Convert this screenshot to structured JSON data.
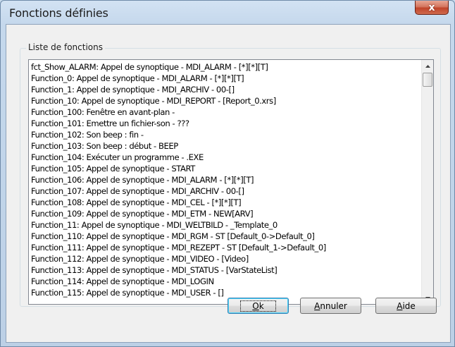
{
  "window": {
    "title": "Fonctions définies",
    "close_label": "x"
  },
  "group": {
    "legend": "Liste de fonctions"
  },
  "functions": [
    "fct_Show_ALARM: Appel de synoptique - MDI_ALARM - [*][*][T]",
    "Function_0: Appel de synoptique - MDI_ALARM - [*][*][T]",
    "Function_1: Appel de synoptique - MDI_ARCHIV - 00-[]",
    "Function_10: Appel de synoptique - MDI_REPORT - [Report_0.xrs]",
    "Function_100: Fenêtre en avant-plan -",
    "Function_101: Emettre un fichier-son - ???",
    "Function_102: Son beep : fin -",
    "Function_103: Son beep : début - BEEP",
    "Function_104: Exécuter un programme - .EXE",
    "Function_105: Appel de synoptique - START",
    "Function_106: Appel de synoptique - MDI_ALARM - [*][*][T]",
    "Function_107: Appel de synoptique - MDI_ARCHIV - 00-[]",
    "Function_108: Appel de synoptique - MDI_CEL - [*][*][T]",
    "Function_109: Appel de synoptique - MDI_ETM - NEW[ARV]",
    "Function_11: Appel de synoptique - MDI_WELTBILD - _Template_0",
    "Function_110: Appel de synoptique - MDI_RGM - ST [Default_0->Default_0]",
    "Function_111: Appel de synoptique - MDI_REZEPT - ST [Default_1->Default_0]",
    "Function_112: Appel de synoptique - MDI_VIDEO - [Video]",
    "Function_113: Appel de synoptique - MDI_STATUS - [VarStateList]",
    "Function_114: Appel de synoptique - MDI_LOGIN",
    "Function_115: Appel de synoptique - MDI_USER - []"
  ],
  "buttons": {
    "ok_label": "Ok",
    "ok_mnemonic": "O",
    "ok_rest": "k",
    "cancel_label": "Annuler",
    "cancel_mnemonic": "A",
    "cancel_rest": "nnuler",
    "help_label": "Aide",
    "help_mnemonic": "A",
    "help_rest": "ide"
  },
  "icons": {
    "scroll_up": "triangle-up-icon",
    "scroll_down": "triangle-down-icon"
  }
}
